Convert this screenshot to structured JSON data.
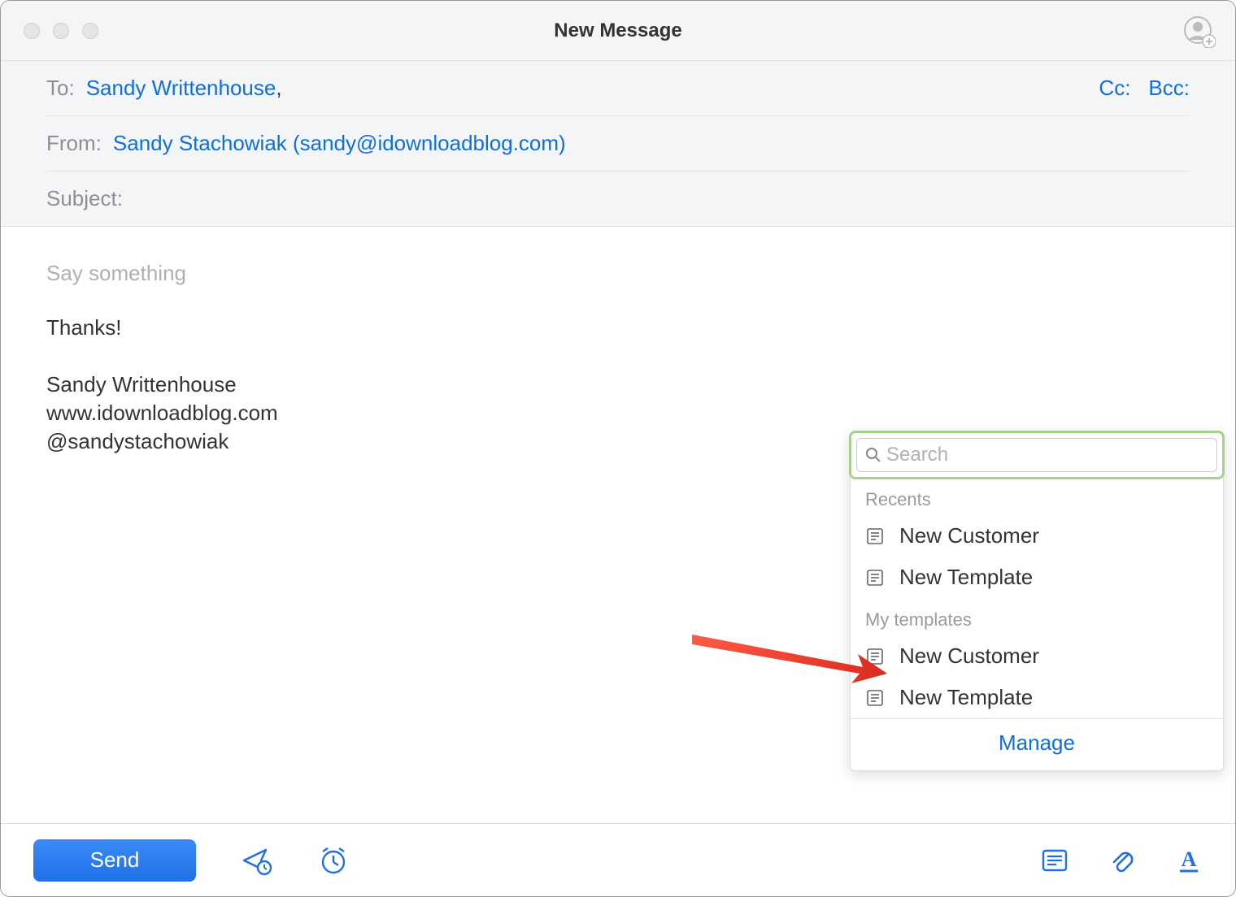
{
  "window": {
    "title": "New Message"
  },
  "fields": {
    "to_label": "To:",
    "to_value": "Sandy Writtenhouse",
    "cc_label": "Cc:",
    "bcc_label": "Bcc:",
    "from_label": "From:",
    "from_value": "Sandy Stachowiak (sandy@idownloadblog.com)",
    "subject_label": "Subject:",
    "subject_value": ""
  },
  "body": {
    "placeholder": "Say something",
    "content": "Thanks!",
    "signature_name": "Sandy Writtenhouse",
    "signature_url": "www.idownloadblog.com",
    "signature_handle": "@sandystachowiak"
  },
  "templates": {
    "search_placeholder": "Search",
    "recents_label": "Recents",
    "recents": [
      "New Customer",
      "New Template"
    ],
    "my_templates_label": "My templates",
    "my_templates": [
      "New Customer",
      "New Template"
    ],
    "manage_label": "Manage"
  },
  "toolbar": {
    "send_label": "Send"
  }
}
